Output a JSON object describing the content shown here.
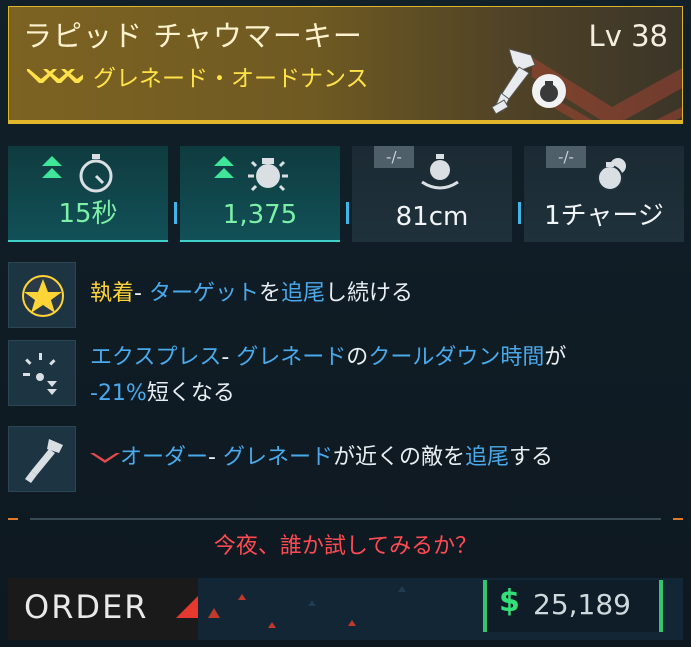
{
  "item": {
    "name": "ラピッド チャウマーキー",
    "type": "グレネード・オードナンス",
    "level": "Lv 38"
  },
  "stats": [
    {
      "value": "15秒",
      "icon": "stopwatch-icon",
      "indicator": "up"
    },
    {
      "value": "1,375",
      "icon": "grenade-blast-icon",
      "indicator": "up"
    },
    {
      "value": "81cm",
      "icon": "grenade-radius-icon",
      "indicator": "-/-"
    },
    {
      "value": "1チャージ",
      "icon": "grenade-charges-icon",
      "indicator": "-/-"
    }
  ],
  "perks": [
    {
      "name": "執着",
      "sep": "- ",
      "desc": [
        {
          "t": "ターゲット",
          "c": "b"
        },
        {
          "t": "を",
          "c": ""
        },
        {
          "t": "追尾",
          "c": "b"
        },
        {
          "t": "し続ける",
          "c": ""
        }
      ]
    },
    {
      "name": "エクスプレス",
      "sep": "- ",
      "desc": [
        {
          "t": "グレネード",
          "c": "b"
        },
        {
          "t": "の",
          "c": ""
        },
        {
          "t": "クールダウン時間",
          "c": "b"
        },
        {
          "t": "が",
          "c": ""
        }
      ],
      "desc2": [
        {
          "t": "-21%",
          "c": "b"
        },
        {
          "t": "短くなる",
          "c": ""
        }
      ]
    },
    {
      "name": "オーダー",
      "sep": "- ",
      "desc": [
        {
          "t": "グレネード",
          "c": "b"
        },
        {
          "t": "が近くの敵を",
          "c": ""
        },
        {
          "t": "追尾",
          "c": "b"
        },
        {
          "t": "する",
          "c": ""
        }
      ]
    }
  ],
  "flavor": "今夜、誰か試してみるか？",
  "footer": {
    "manufacturer": "ORDER",
    "currency_symbol": "$",
    "price": "25,189"
  },
  "colors": {
    "accent_gold": "#e2b62a",
    "stat_positive": "#7cf0a6",
    "keyword_blue": "#49a9ea",
    "flavor_red": "#ff4a52",
    "price_green": "#34c46c"
  }
}
